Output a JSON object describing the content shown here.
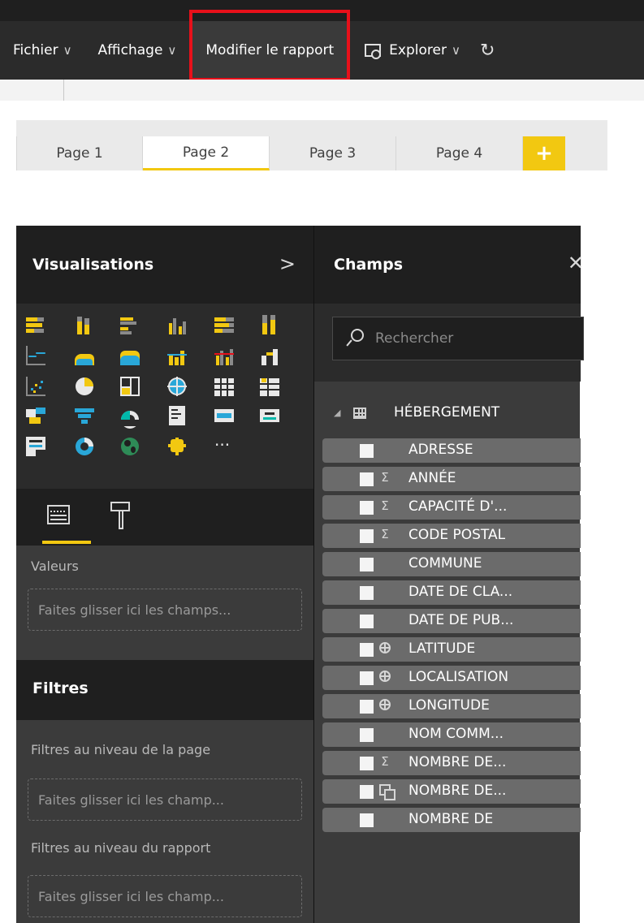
{
  "menubar": {
    "items": [
      {
        "label": "Fichier",
        "has_chevron": true
      },
      {
        "label": "Affichage",
        "has_chevron": true
      },
      {
        "label": "Modifier le rapport",
        "has_chevron": false,
        "highlighted": true
      },
      {
        "label": "Explorer",
        "has_chevron": true,
        "icon": "explore-icon"
      }
    ],
    "chevron": "∨",
    "refresh_glyph": "↻",
    "highlight_color": "#e8101a"
  },
  "tabs": {
    "pages": [
      "Page 1",
      "Page 2",
      "Page 3",
      "Page 4"
    ],
    "active_index": 1,
    "add_glyph": "+",
    "accent": "#f2c811"
  },
  "visualisations": {
    "title": "Visualisations",
    "expand_glyph": ">",
    "more_glyph": "···",
    "values_label": "Valeurs",
    "values_dropzone": "Faites glisser ici les champs..."
  },
  "filters": {
    "title": "Filtres",
    "page_level_label": "Filtres au niveau de la page",
    "page_dropzone": "Faites glisser ici les champ...",
    "report_level_label": "Filtres au niveau du rapport",
    "report_dropzone": "Faites glisser ici les champ..."
  },
  "champs": {
    "title": "Champs",
    "close_glyph": "✕",
    "search_placeholder": "Rechercher",
    "table_name": "HÉBERGEMENT",
    "collapse_glyph": "◢",
    "fields": [
      {
        "name": "ADRESSE",
        "type": "none"
      },
      {
        "name": "ANNÉE",
        "type": "sum"
      },
      {
        "name": "CAPACITÉ D'...",
        "type": "sum"
      },
      {
        "name": "CODE POSTAL",
        "type": "sum"
      },
      {
        "name": "COMMUNE",
        "type": "none"
      },
      {
        "name": "DATE DE CLA...",
        "type": "none"
      },
      {
        "name": "DATE DE PUB...",
        "type": "none"
      },
      {
        "name": "LATITUDE",
        "type": "geo"
      },
      {
        "name": "LOCALISATION",
        "type": "geo"
      },
      {
        "name": "LONGITUDE",
        "type": "geo"
      },
      {
        "name": "NOM COMM...",
        "type": "none"
      },
      {
        "name": "NOMBRE DE...",
        "type": "sum"
      },
      {
        "name": "NOMBRE DE...",
        "type": "hierarchy"
      },
      {
        "name": "NOMBRE DE",
        "type": "none"
      }
    ],
    "sum_glyph": "Σ"
  },
  "colors": {
    "chart_blue": "#29a7d8",
    "chart_yellow": "#f2c811",
    "chart_grey": "#8a8a8a",
    "chart_dark": "#1f1f1f",
    "chart_teal": "#01b8aa"
  }
}
